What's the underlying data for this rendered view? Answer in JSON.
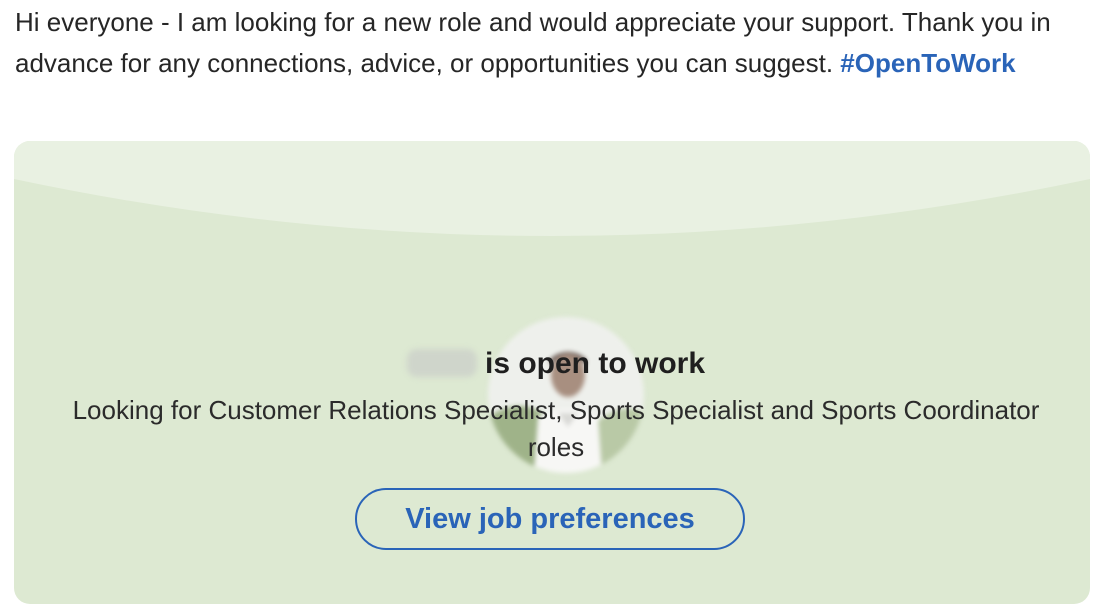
{
  "post": {
    "text": "Hi everyone - I am looking for a new role and would appreciate your support. Thank you in advance for any connections, advice, or opportunities you can suggest.",
    "hashtag": "#OpenToWork"
  },
  "open_to_work_card": {
    "status_text": "is open to work",
    "roles_text": "Looking for Customer Relations Specialist, Sports Specialist and Sports Coordinator roles",
    "button_label": "View job preferences",
    "colors": {
      "card_background": "#dde9d2",
      "banner_background": "#e9f1e2",
      "link_blue": "#2a64b8"
    }
  }
}
